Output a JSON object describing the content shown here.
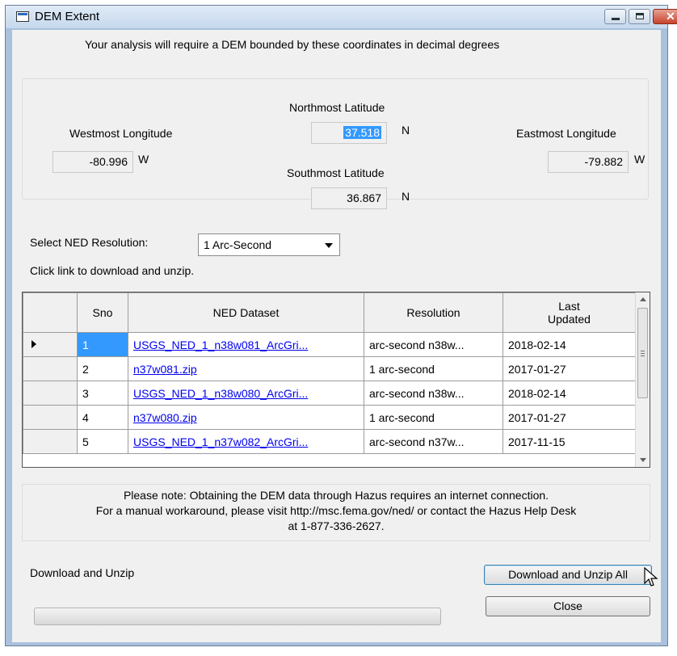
{
  "window": {
    "title": "DEM Extent"
  },
  "intro": "Your analysis will require a DEM bounded by these coordinates in decimal degrees",
  "extent": {
    "north_label": "Northmost Latitude",
    "north_value": "37.518",
    "north_unit": "N",
    "south_label": "Southmost Latitude",
    "south_value": "36.867",
    "south_unit": "N",
    "west_label": "Westmost Longitude",
    "west_value": "-80.996",
    "west_unit": "W",
    "east_label": "Eastmost Longitude",
    "east_value": "-79.882",
    "east_unit": "W"
  },
  "resolution": {
    "label": "Select NED Resolution:",
    "selected": "1 Arc-Second",
    "hint": "Click link to download and unzip."
  },
  "grid": {
    "columns": [
      "Sno",
      "NED Dataset",
      "Resolution",
      "Last Updated"
    ],
    "rows": [
      {
        "sno": "1",
        "dataset": "USGS_NED_1_n38w081_ArcGri...",
        "resolution": "arc-second n38w...",
        "updated": "2018-02-14"
      },
      {
        "sno": "2",
        "dataset": "n37w081.zip",
        "resolution": "1 arc-second",
        "updated": "2017-01-27"
      },
      {
        "sno": "3",
        "dataset": "USGS_NED_1_n38w080_ArcGri...",
        "resolution": "arc-second n38w...",
        "updated": "2018-02-14"
      },
      {
        "sno": "4",
        "dataset": "n37w080.zip",
        "resolution": "1 arc-second",
        "updated": "2017-01-27"
      },
      {
        "sno": "5",
        "dataset": "USGS_NED_1_n37w082_ArcGri...",
        "resolution": "arc-second n37w...",
        "updated": "2017-11-15"
      }
    ]
  },
  "note": {
    "line1": "Please note: Obtaining the DEM data through Hazus requires an internet connection.",
    "line2": "For a manual workaround, please visit http://msc.fema.gov/ned/ or contact the Hazus Help Desk",
    "line3": "at 1-877-336-2627."
  },
  "status_label": "Download and Unzip",
  "buttons": {
    "download_all": "Download and Unzip All",
    "close": "Close"
  },
  "progress": {
    "fraction": 0
  },
  "colors": {
    "selection": "#3399ff",
    "link": "#0000ee",
    "title_bar": "#c6d8ed"
  }
}
